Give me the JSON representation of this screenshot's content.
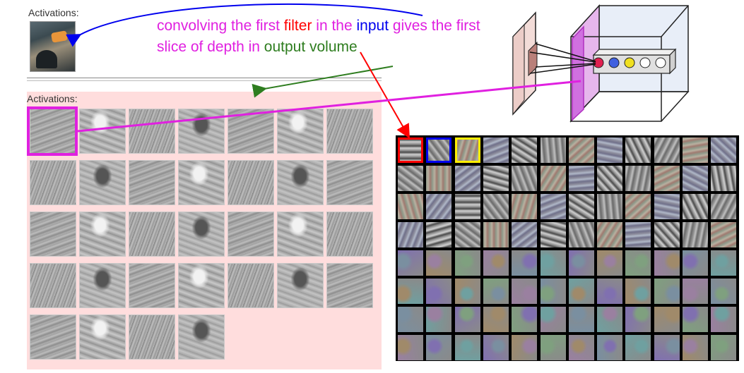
{
  "top": {
    "label": "Activations:"
  },
  "panel": {
    "label": "Activations:",
    "activation_count": 32,
    "columns": 7
  },
  "caption": {
    "part1": "convolving the first ",
    "filter_word": "filter",
    "part2": " in the ",
    "input_word": "input",
    "part3": " gives the first slice of depth in ",
    "output_word": "output volume"
  },
  "filter_grid": {
    "rows": 8,
    "cols": 12,
    "highlight_colors": [
      "#ff0000",
      "#0000ee",
      "#ffee00"
    ]
  },
  "colors": {
    "magenta": "#e020e0",
    "arrow_blue": "#0000ee",
    "arrow_green": "#2e7d1f",
    "arrow_red": "#ff0000"
  }
}
